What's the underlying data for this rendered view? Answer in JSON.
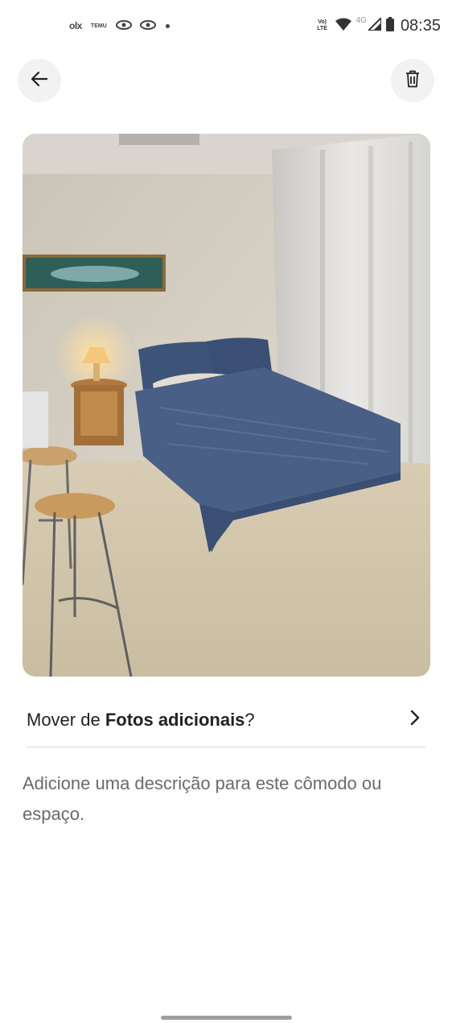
{
  "status_bar": {
    "notif_olx": "olx",
    "notif_temu": "TEMU",
    "volte_label": "Vo) LTE",
    "network_label": "4G",
    "time": "08:35"
  },
  "header": {
    "back_icon": "arrow-left-icon",
    "delete_icon": "trash-icon"
  },
  "photo": {
    "subject": "bedroom"
  },
  "move_row": {
    "prefix": "Mover de ",
    "category": "Fotos adicionais",
    "suffix": "?"
  },
  "description": {
    "placeholder": "Adicione uma descrição para este cômodo ou espaço."
  }
}
